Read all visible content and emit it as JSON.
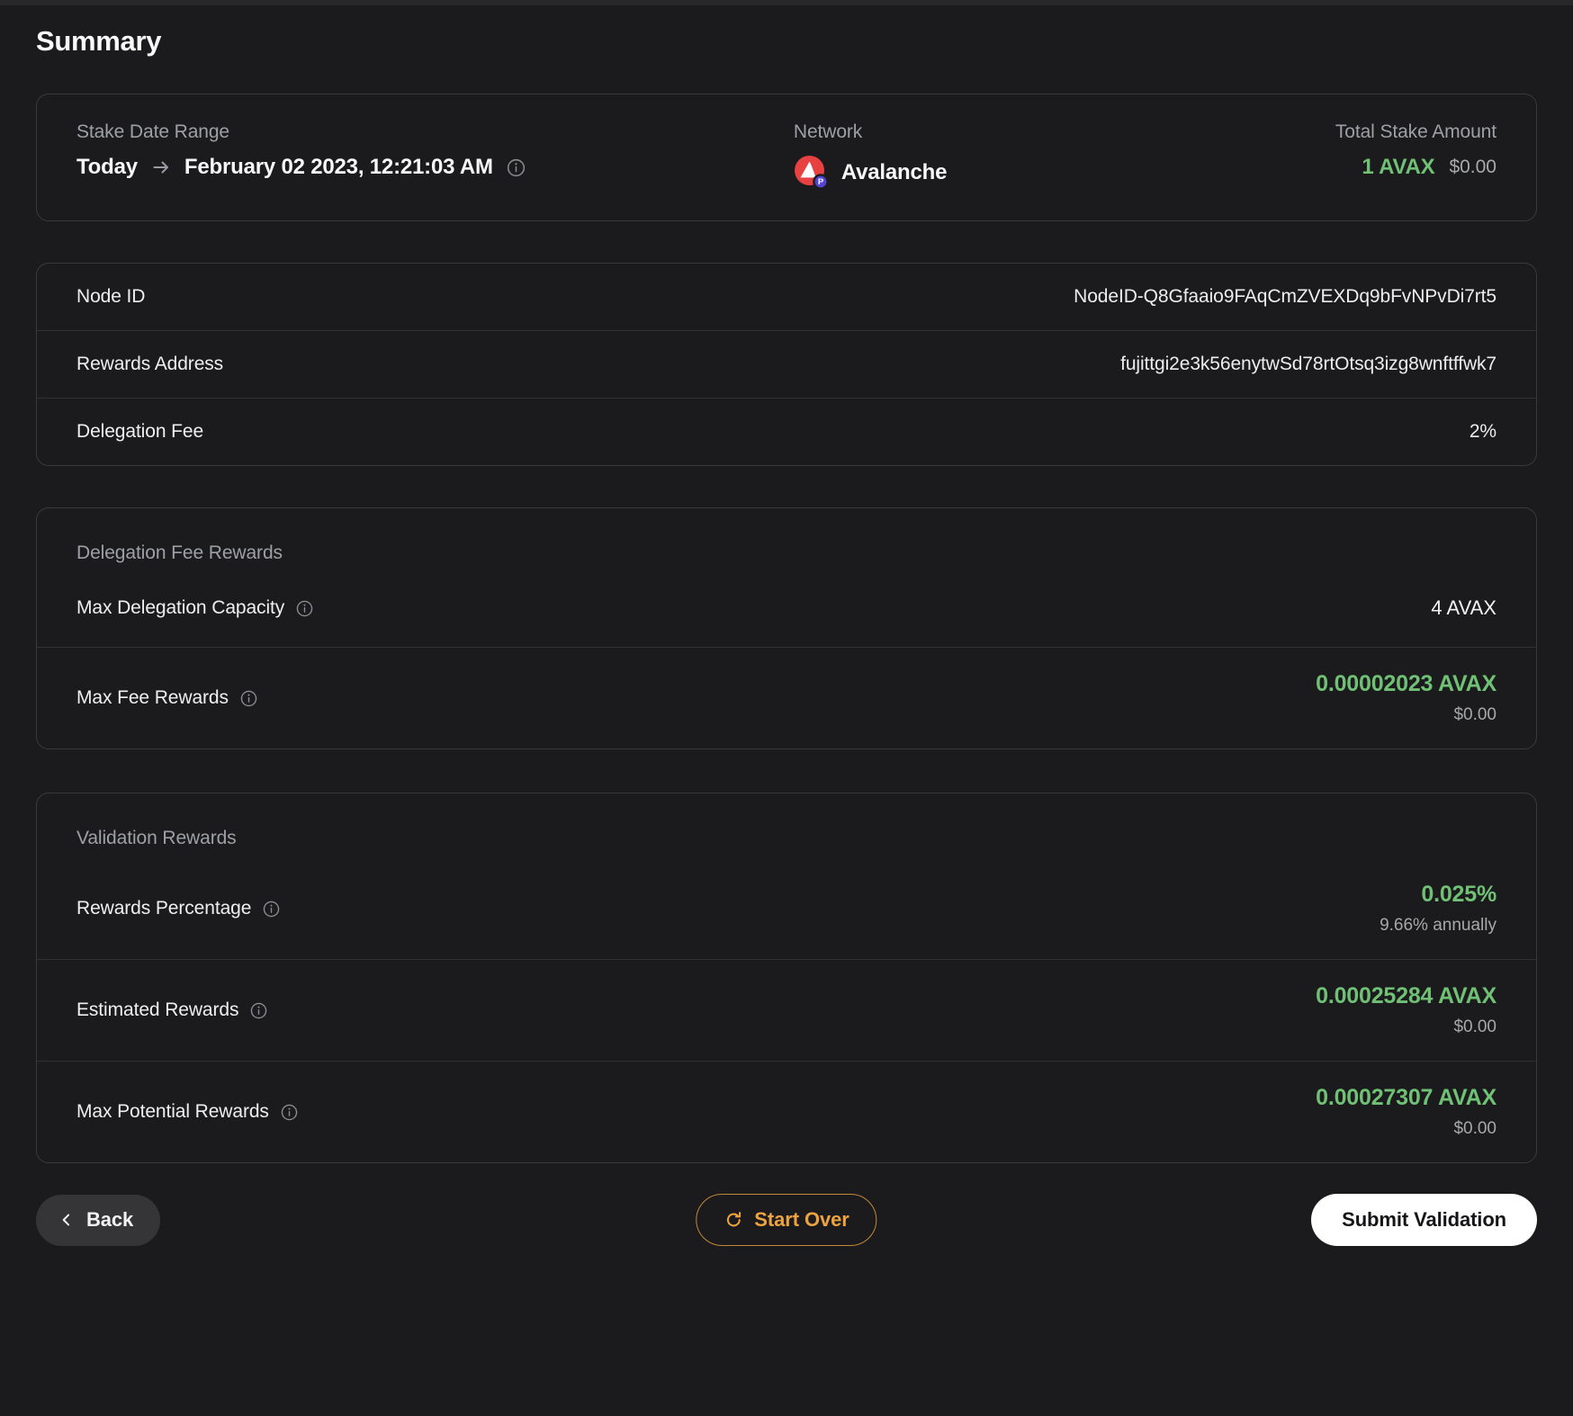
{
  "page": {
    "title": "Summary"
  },
  "colors": {
    "accent_green": "#70C175",
    "accent_orange": "#EDA33F",
    "avalanche_red": "#E84142",
    "badge_purple": "#5244D4"
  },
  "summary_card": {
    "stake_date_range": {
      "label": "Stake Date Range",
      "from": "Today",
      "to": "February 02 2023, 12:21:03 AM"
    },
    "network": {
      "label": "Network",
      "value": "Avalanche",
      "badge": "P"
    },
    "total_stake": {
      "label": "Total Stake Amount",
      "amount": "1 AVAX",
      "usd": "$0.00"
    }
  },
  "details_table": {
    "rows": [
      {
        "label": "Node ID",
        "value": "NodeID-Q8Gfaaio9FAqCmZVEXDq9bFvNPvDi7rt5"
      },
      {
        "label": "Rewards Address",
        "value": "fujittgi2e3k56enytwSd78rtOtsq3izg8wnftffwk7"
      },
      {
        "label": "Delegation Fee",
        "value": "2%"
      }
    ]
  },
  "delegation_fee_rewards": {
    "title": "Delegation Fee Rewards",
    "max_delegation_capacity": {
      "label": "Max Delegation Capacity",
      "value": "4 AVAX"
    },
    "max_fee_rewards": {
      "label": "Max Fee Rewards",
      "value": "0.00002023 AVAX",
      "usd": "$0.00"
    }
  },
  "validation_rewards": {
    "title": "Validation Rewards",
    "rows": [
      {
        "label": "Rewards Percentage",
        "value": "0.025%",
        "sub": "9.66% annually"
      },
      {
        "label": "Estimated Rewards",
        "value": "0.00025284 AVAX",
        "sub": "$0.00"
      },
      {
        "label": "Max Potential Rewards",
        "value": "0.00027307 AVAX",
        "sub": "$0.00"
      }
    ]
  },
  "actions": {
    "back": "Back",
    "start_over": "Start Over",
    "submit": "Submit Validation"
  }
}
